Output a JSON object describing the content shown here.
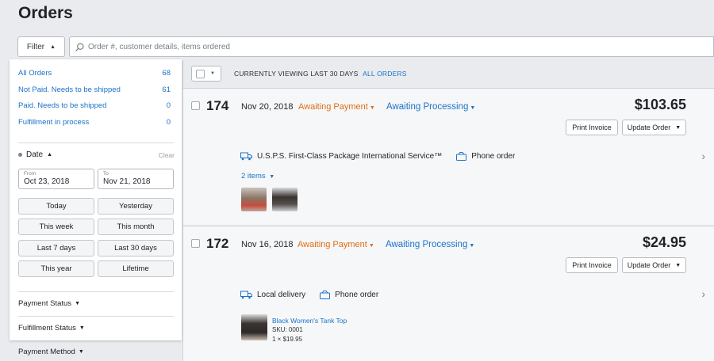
{
  "page_title": "Orders",
  "filter_button": {
    "label": "Filter"
  },
  "search": {
    "placeholder": "Order #, customer details, items ordered"
  },
  "panel": {
    "statuses": [
      {
        "label": "All Orders",
        "count": "68"
      },
      {
        "label": "Not Paid. Needs to be shipped",
        "count": "61"
      },
      {
        "label": "Paid. Needs to be shipped",
        "count": "0"
      },
      {
        "label": "Fulfillment in process",
        "count": "0"
      }
    ],
    "date": {
      "title": "Date",
      "clear": "Clear",
      "from_label": "From",
      "from_value": "Oct 23, 2018",
      "to_label": "To",
      "to_value": "Nov 21, 2018",
      "presets": [
        "Today",
        "Yesterday",
        "This week",
        "This month",
        "Last 7 days",
        "Last 30 days",
        "This year",
        "Lifetime"
      ]
    },
    "sections": [
      "Payment Status",
      "Fulfillment Status"
    ],
    "outside_section": "Payment Method"
  },
  "list_header": {
    "viewing": "CURRENTLY VIEWING LAST 30 DAYS",
    "link": "ALL ORDERS"
  },
  "orders": [
    {
      "number": "174",
      "date": "Nov 20, 2018",
      "payment_status": "Awaiting Payment",
      "fulfillment_status": "Awaiting Processing",
      "total": "$103.65",
      "print_label": "Print Invoice",
      "update_label": "Update Order",
      "shipping": "U.S.P.S. First-Class Package International Service™",
      "source": "Phone order",
      "items_link": "2 items"
    },
    {
      "number": "172",
      "date": "Nov 16, 2018",
      "payment_status": "Awaiting Payment",
      "fulfillment_status": "Awaiting Processing",
      "total": "$24.95",
      "print_label": "Print Invoice",
      "update_label": "Update Order",
      "shipping": "Local delivery",
      "source": "Phone order",
      "product_name": "Black Women's Tank Top",
      "product_sku": "SKU: 0001",
      "product_qty": "1 × $19.95"
    }
  ],
  "colors": {
    "link": "#1b72c8",
    "payment_orange": "#e06d15",
    "background": "#e9ebee"
  }
}
